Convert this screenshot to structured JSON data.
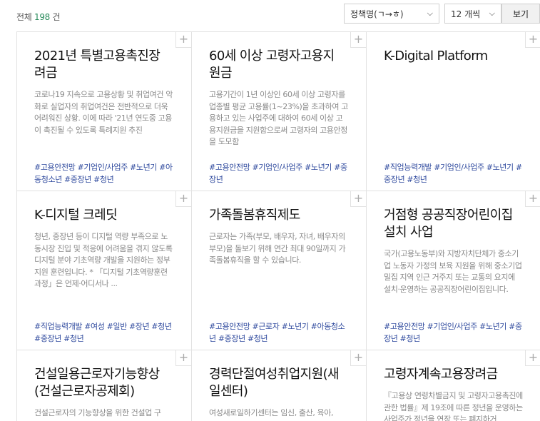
{
  "summary": {
    "prefix": "전체",
    "count": "198",
    "suffix": "건"
  },
  "controls": {
    "sort_select": "정책명(ㄱ→ㅎ)",
    "per_page_select": "12 개씩",
    "view_button": "보기"
  },
  "cards": [
    {
      "title": "2021년 특별고용촉진장려금",
      "desc": "코로나19 지속으로 고용상황 및 취업여건 악화로 실업자의 취업여건은 전반적으로 더욱 어려워진 상황. 이에 따라 '21년 연도중 고용이 촉진될 수 있도록 특례지원 추진",
      "tags": "#고용안전망 #기업인/사업주 #노년기 #아동청소년 #중장년 #청년"
    },
    {
      "title": "60세 이상 고령자고용지원금",
      "desc": "고용기간이 1년 이상인 60세 이상 고령자를 업종별 평균 고용률(1~23%)을 초과하여 고용하고 있는 사업주에 대하여 60세 이상 고용지원금을 지원함으로써 고령자의 고용안정을 도모함",
      "tags": "#고용안전망 #기업인/사업주 #노년기 #중장년"
    },
    {
      "title": "K-Digital Platform",
      "desc": "",
      "tags": "#직업능력개발 #기업인/사업주 #노년기 #중장년 #청년"
    },
    {
      "title": "K-디지털 크레딧",
      "desc": "청년, 중장년 등이 디지털 역량 부족으로 노동시장 진입 및 적응에 어려움을 겪지 않도록 디지털 분야 기초역량 개발을 지원하는 정부지원 훈련입니다. * 「디지털 기초역량훈련과정」은 언제·어디서나 ...",
      "tags": "#직업능력개발 #여성 #일반 #장년 #청년 #중장년 #청년"
    },
    {
      "title": "가족돌봄휴직제도",
      "desc": "근로자는 가족(부모, 배우자, 자녀, 배우자의 부모)을 돌보기 위해 연간 최대 90일까지 가족돌봄휴직을 할 수 있습니다.",
      "tags": "#고용안전망 #근로자 #노년기 #아동청소년 #중장년 #청년"
    },
    {
      "title": "거점형 공공직장어린이집 설치 사업",
      "desc": "국가(고용노동부)와 지방자치단체가 중소기업 노동자 가정의 보육 지원을 위해 중소기업 밀집 지역 인근 거주지 또는 교통의 요지에 설치·운영하는 공공직장어린이집입니다.",
      "tags": "#고용안전망 #기업인/사업주 #노년기 #중장년 #청년"
    },
    {
      "title": "건설일용근로자기능향상(건설근로자공제회)",
      "desc": "건설근로자의 기능향상을 위한 건설업 구",
      "tags": ""
    },
    {
      "title": "경력단절여성취업지원(새일센터)",
      "desc": "여성새로일하기센터는 임신, 출산, 육아,",
      "tags": ""
    },
    {
      "title": "고령자계속고용장려금",
      "desc": "『고용상 연령차별금지 및 고령자고용촉진에 관한 법률』제 19조에 따른 정년을 운영하는 사업주가 정년을 연장 또는 폐지하거",
      "tags": ""
    }
  ]
}
